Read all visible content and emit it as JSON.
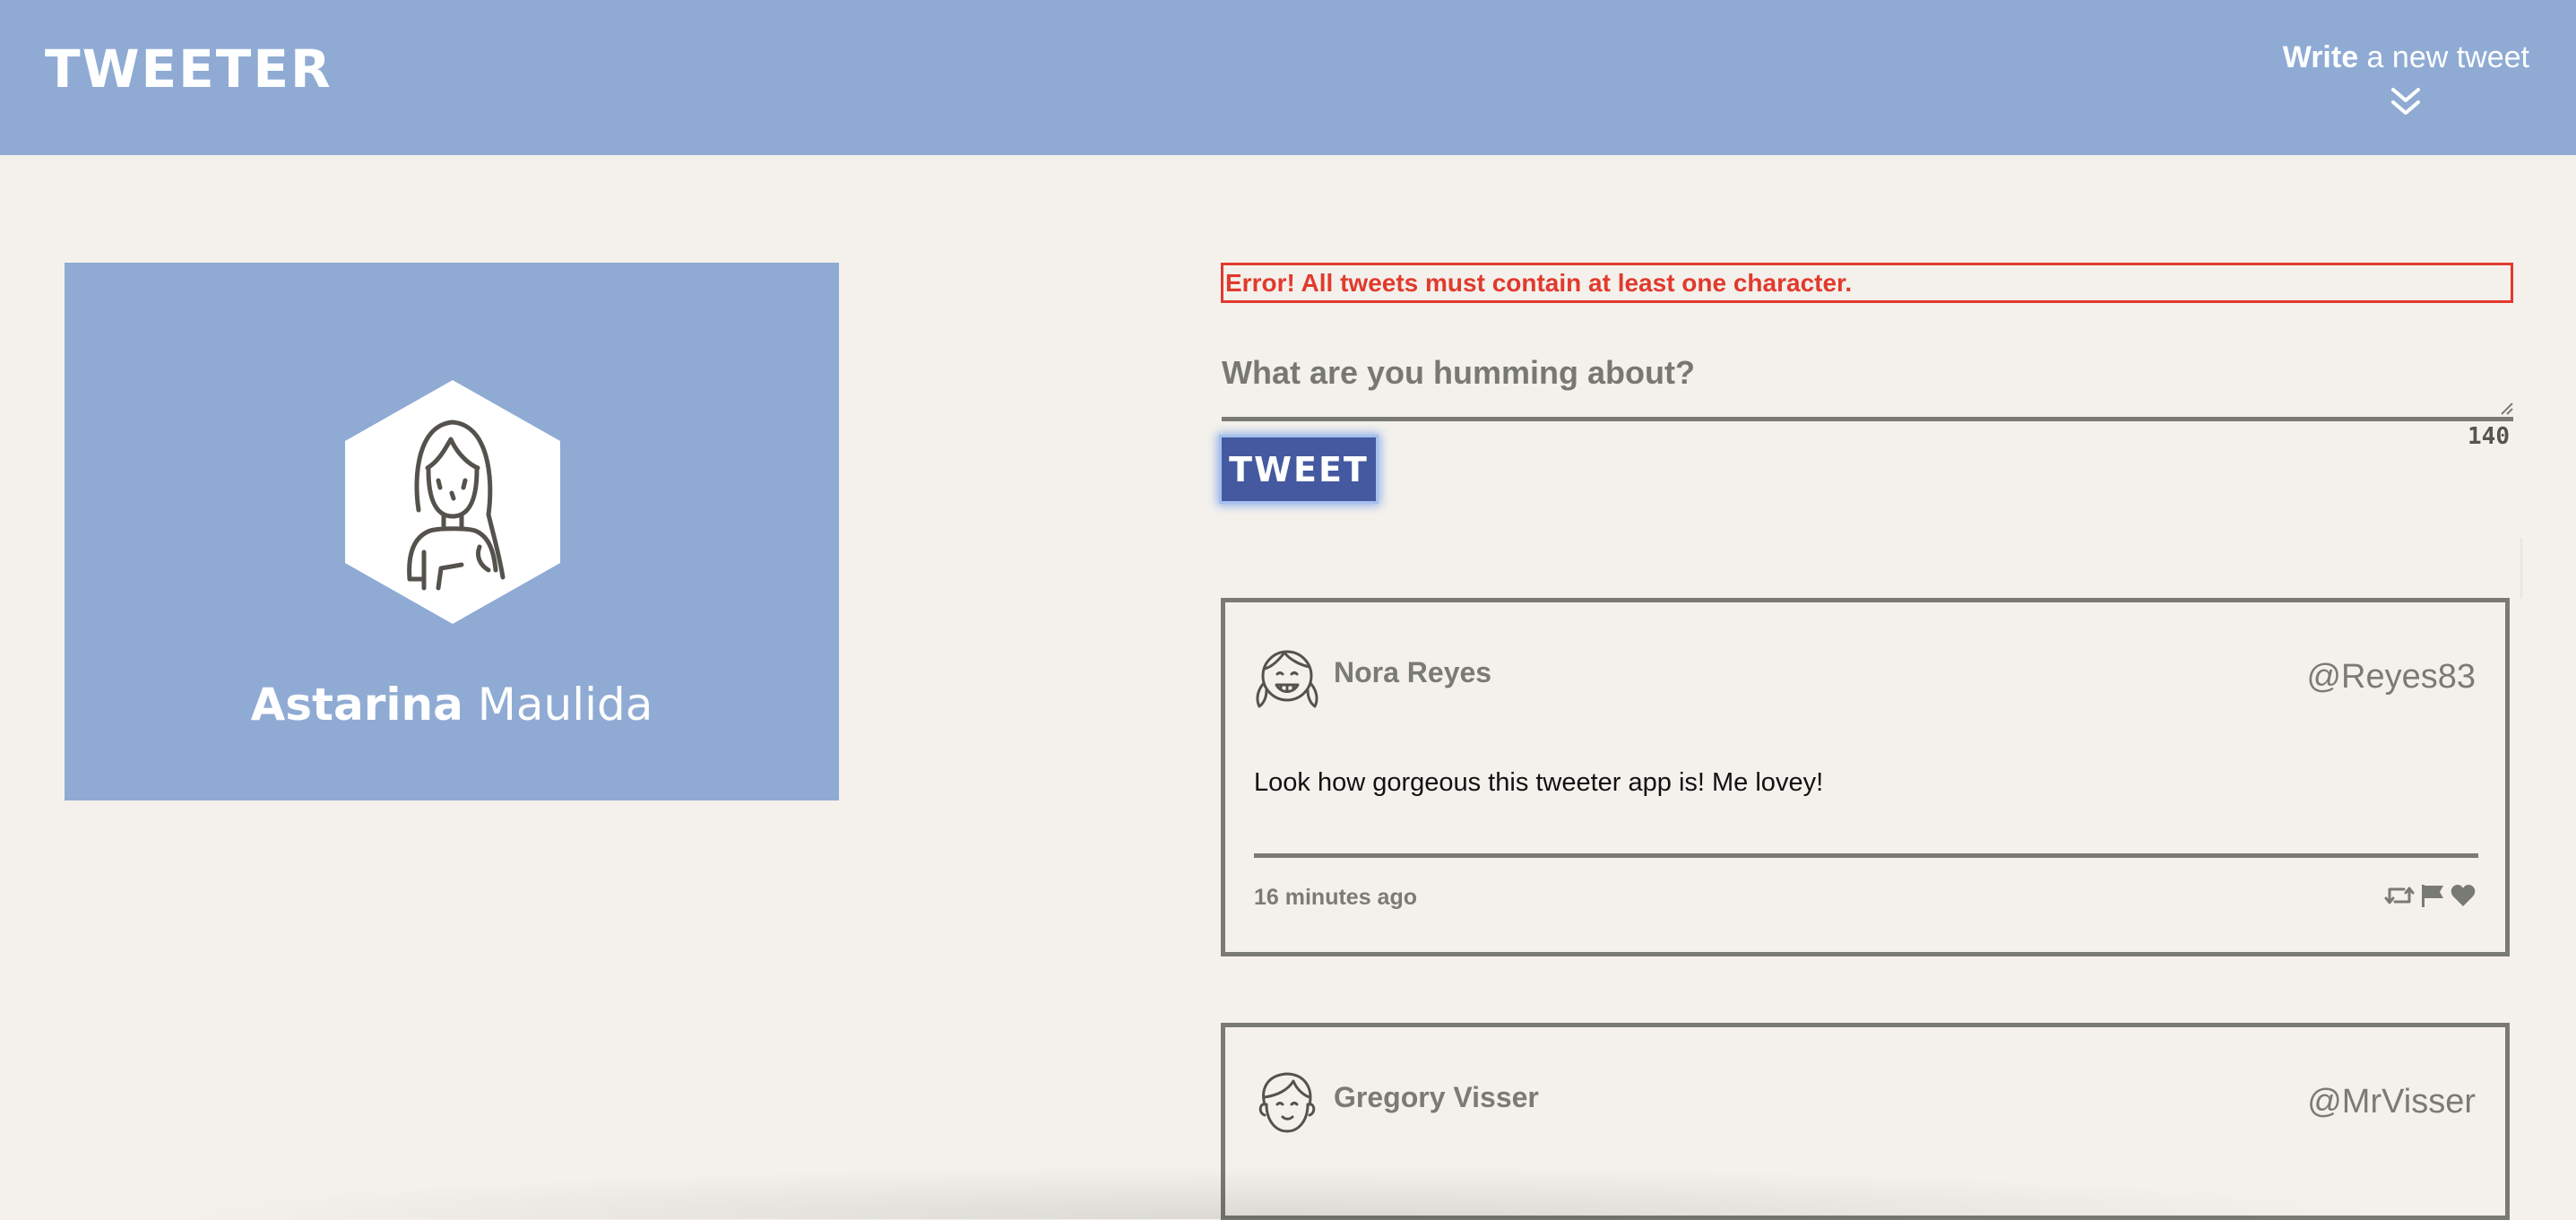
{
  "nav": {
    "logo": "TWEETER",
    "compose_bold": "Write",
    "compose_rest": " a new tweet",
    "compose_icon": "double-chevron-down-icon"
  },
  "profile": {
    "first_name": "Astarina",
    "last_name": "Maulida",
    "avatar_icon": "woman-avatar-icon"
  },
  "composer": {
    "error": "Error! All tweets must contain at least one character.",
    "placeholder": "What are you humming about?",
    "value": "",
    "counter": "140",
    "button_label": "TWEET"
  },
  "tweets": [
    {
      "name": "Nora Reyes",
      "handle": "@Reyes83",
      "body": "Look how gorgeous this tweeter app is! Me lovey!",
      "time": "16 minutes ago",
      "avatar_icon": "girl-avatar-icon",
      "actions": [
        "retweet-icon",
        "flag-icon",
        "heart-icon"
      ]
    },
    {
      "name": "Gregory Visser",
      "handle": "@MrVisser",
      "avatar_icon": "boy-avatar-icon"
    }
  ],
  "colors": {
    "nav_bg": "#8fabd4",
    "page_bg": "#f4f1ec",
    "error": "#e13a2d",
    "button_bg": "#4459a0",
    "border_gray": "#7a7a74"
  }
}
